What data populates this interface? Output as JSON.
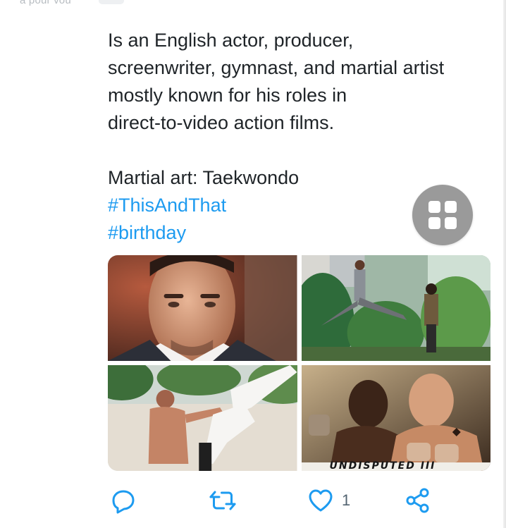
{
  "header": {
    "faded_text": "a pour vou"
  },
  "tweet": {
    "body": "Is an English actor, producer,\nscreenwriter, gymnast, and martial artist\nmostly known for his roles in\ndirect-to-video action films.",
    "martial_art_line": "Martial art: Taekwondo",
    "hashtags": [
      "#ThisAndThat",
      "#birthday"
    ]
  },
  "media": {
    "images": [
      {
        "description": "portrait-closeup"
      },
      {
        "description": "flying-kick-outdoor"
      },
      {
        "description": "shirtless-training-kick"
      },
      {
        "description": "movie-poster",
        "caption": "UNDISPUTED III"
      }
    ]
  },
  "actions": {
    "reply_icon": "reply-icon",
    "retweet_icon": "retweet-icon",
    "like_icon": "heart-icon",
    "like_count": "1",
    "share_icon": "share-icon"
  },
  "colors": {
    "text": "#1f2428",
    "link": "#1d9bf0",
    "icon": "#1d9bf0",
    "fab": "#9a9a9a"
  }
}
